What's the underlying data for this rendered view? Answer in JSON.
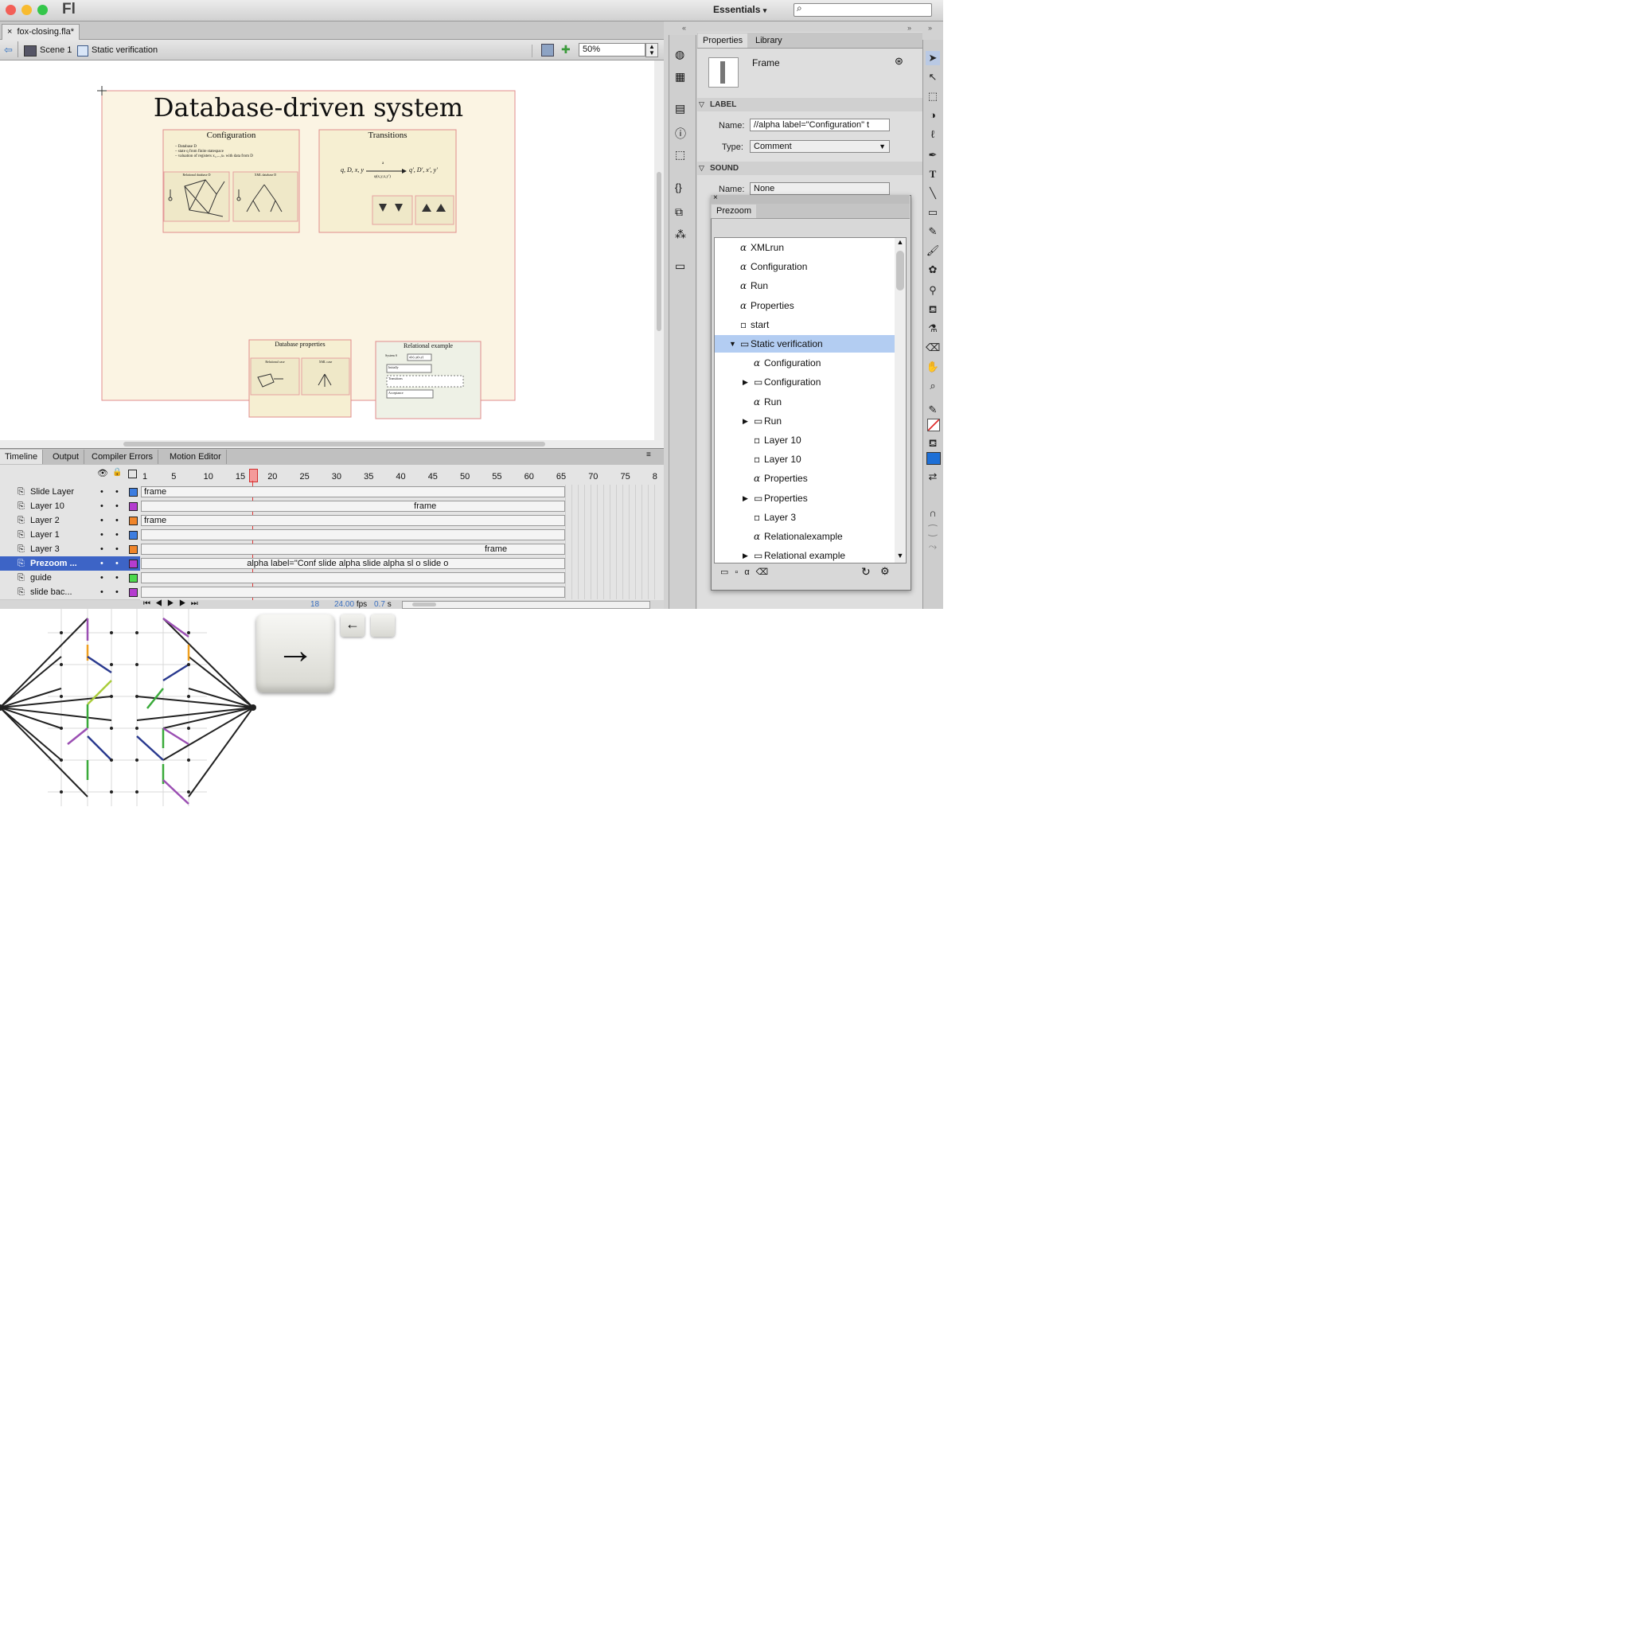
{
  "app": {
    "logo": "Fl",
    "workspace": "Essentials",
    "document_tab": "fox-closing.fla*"
  },
  "editbar": {
    "scene": "Scene 1",
    "symbol": "Static verification",
    "zoom": "50%"
  },
  "slide": {
    "title": "Database-driven system",
    "boxes": [
      {
        "title": "Configuration",
        "lines": [
          "– Database D",
          "– state q from finite statespace",
          "– valuation of registers x₁,...,xₖ with data from D"
        ],
        "sub_a": "Relational database D",
        "sub_b": "XML database D"
      },
      {
        "title": "Transitions",
        "formula_left": "q, D, x, y",
        "formula_right": "q′, D′, x′, y′",
        "formula_arrow_top": "a",
        "formula_arrow_bottom": "φ(x,y,x,y′)"
      },
      {
        "title": "Database properties",
        "sub_a": "Relational case",
        "sub_b": "XML case"
      },
      {
        "title": "Relational example",
        "items": [
          "System S",
          "a(x), p(x,y)",
          "Initially",
          "Transitions",
          "Acceptance"
        ]
      }
    ]
  },
  "timeline": {
    "tabs": [
      "Timeline",
      "Output",
      "Compiler Errors",
      "Motion Editor"
    ],
    "ruler": [
      "1",
      "5",
      "10",
      "15",
      "20",
      "25",
      "30",
      "35",
      "40",
      "45",
      "50",
      "55",
      "60",
      "65",
      "70",
      "75",
      "8"
    ],
    "layers": [
      {
        "name": "Slide Layer",
        "color": "#3d7de0",
        "frame_text": "frame",
        "frame_start": 0
      },
      {
        "name": "Layer 10",
        "color": "#b43ccf",
        "frame_text": "frame",
        "frame_start": 42
      },
      {
        "name": "Layer 2",
        "color": "#f0852a",
        "frame_text": "frame",
        "frame_start": 0
      },
      {
        "name": "Layer 1",
        "color": "#3d7de0",
        "frame_text": "",
        "frame_start": 0
      },
      {
        "name": "Layer 3",
        "color": "#f0852a",
        "frame_text": "frame",
        "frame_start": 53
      },
      {
        "name": "Prezoom ...",
        "color": "#b43ccf",
        "frame_text": "alpha label=\"Conf slide alpha slide alpha sl o slide o",
        "frame_start": 16
      },
      {
        "name": "guide",
        "color": "#4ed94e",
        "frame_text": "",
        "frame_start": 0
      },
      {
        "name": "slide bac...",
        "color": "#b43ccf",
        "frame_text": "",
        "frame_start": 0
      }
    ],
    "status": {
      "frame": "18",
      "fps": "24.00",
      "fps_unit": "fps",
      "time": "0.7",
      "time_unit": "s"
    }
  },
  "properties": {
    "tabs": [
      "Properties",
      "Library"
    ],
    "type": "Frame",
    "label_section": "LABEL",
    "name_label": "Name:",
    "name_value": "//alpha label=\"Configuration\" t",
    "type_label": "Type:",
    "type_value": "Comment",
    "sound_section": "SOUND",
    "sound_name_label": "Name:",
    "sound_name_value": "None"
  },
  "prezoom": {
    "title": "Prezoom",
    "tree": [
      {
        "label": "XMLrun",
        "icon": "alpha",
        "indent": 0,
        "expander": ""
      },
      {
        "label": "Configuration",
        "icon": "alpha",
        "indent": 0,
        "expander": ""
      },
      {
        "label": "Run",
        "icon": "alpha",
        "indent": 0,
        "expander": ""
      },
      {
        "label": "Properties",
        "icon": "alpha",
        "indent": 0,
        "expander": ""
      },
      {
        "label": "start",
        "icon": "frame",
        "indent": 0,
        "expander": ""
      },
      {
        "label": "Static verification",
        "icon": "folder",
        "indent": 0,
        "expander": "▼",
        "selected": true
      },
      {
        "label": "Configuration",
        "icon": "alpha",
        "indent": 1,
        "expander": ""
      },
      {
        "label": "Configuration",
        "icon": "folder",
        "indent": 1,
        "expander": "▶"
      },
      {
        "label": "Run",
        "icon": "alpha",
        "indent": 1,
        "expander": ""
      },
      {
        "label": "Run",
        "icon": "folder",
        "indent": 1,
        "expander": "▶"
      },
      {
        "label": "Layer 10",
        "icon": "frame",
        "indent": 1,
        "expander": ""
      },
      {
        "label": "Layer 10",
        "icon": "frame",
        "indent": 1,
        "expander": ""
      },
      {
        "label": "Properties",
        "icon": "alpha",
        "indent": 1,
        "expander": ""
      },
      {
        "label": "Properties",
        "icon": "folder",
        "indent": 1,
        "expander": "▶"
      },
      {
        "label": "Layer 3",
        "icon": "frame",
        "indent": 1,
        "expander": ""
      },
      {
        "label": "Relationalexample",
        "icon": "alpha",
        "indent": 1,
        "expander": ""
      },
      {
        "label": "Relational example",
        "icon": "folder",
        "indent": 1,
        "expander": "▶"
      }
    ]
  },
  "keys": {
    "right_arrow": "→",
    "left_arrow": "←"
  },
  "colors": {
    "selection": "#b3cdf2",
    "slide_bg": "#fbf4e3",
    "slide_border": "#e08c8c",
    "playhead": "#e03a3a"
  }
}
